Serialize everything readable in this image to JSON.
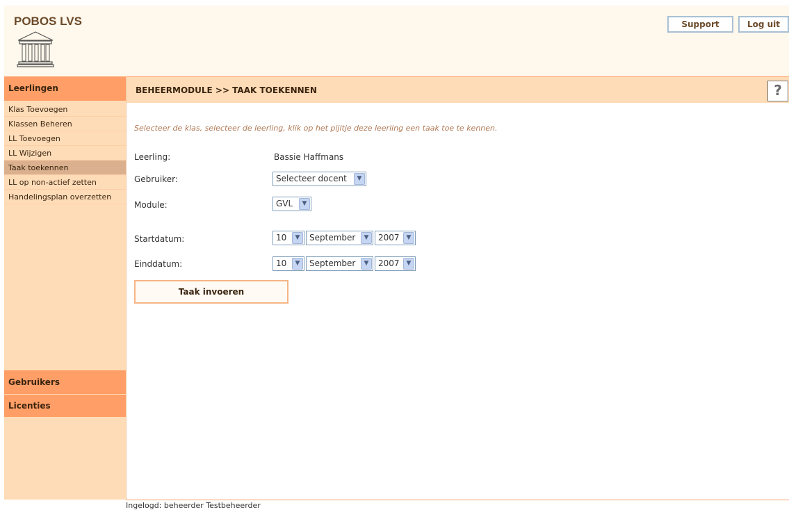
{
  "app": {
    "title": "POBOS LVS",
    "logo_icon": "building-icon",
    "support_label": "Support",
    "logout_label": "Log uit"
  },
  "sidebar": {
    "sections": [
      {
        "label": "Leerlingen"
      },
      {
        "label": "Gebruikers"
      },
      {
        "label": "Licenties"
      }
    ],
    "items": [
      {
        "label": "Klas Toevoegen"
      },
      {
        "label": "Klassen Beheren"
      },
      {
        "label": "LL Toevoegen"
      },
      {
        "label": "LL Wijzigen"
      },
      {
        "label": "Taak toekennen",
        "active": true
      },
      {
        "label": "LL op non-actief zetten"
      },
      {
        "label": "Handelingsplan overzetten"
      }
    ]
  },
  "main": {
    "title": "BEHEERMODULE >> TAAK TOEKENNEN",
    "help_label": "?",
    "instruction": "Selecteer de klas, selecteer de leerling, klik op het pijltje deze leerling een taak toe te kennen.",
    "fields": {
      "leerling": {
        "label": "Leerling:",
        "value": "Bassie Haffmans"
      },
      "gebruiker": {
        "label": "Gebruiker:",
        "value": "Selecteer docent"
      },
      "module": {
        "label": "Module:",
        "value": "GVL"
      },
      "startdatum": {
        "label": "Startdatum:",
        "day": "10",
        "month": "September",
        "year": "2007"
      },
      "einddatum": {
        "label": "Einddatum:",
        "day": "10",
        "month": "September",
        "year": "2007"
      }
    },
    "submit_label": "Taak invoeren"
  },
  "footer": {
    "status": "Ingelogd: beheerder Testbeheerder"
  },
  "colors": {
    "accent": "#ff9e66",
    "sidebar_bg": "#ffdcb8",
    "header_bg": "#fff8ec",
    "active_item": "#dab08e",
    "instruction_text": "#b07a57"
  }
}
